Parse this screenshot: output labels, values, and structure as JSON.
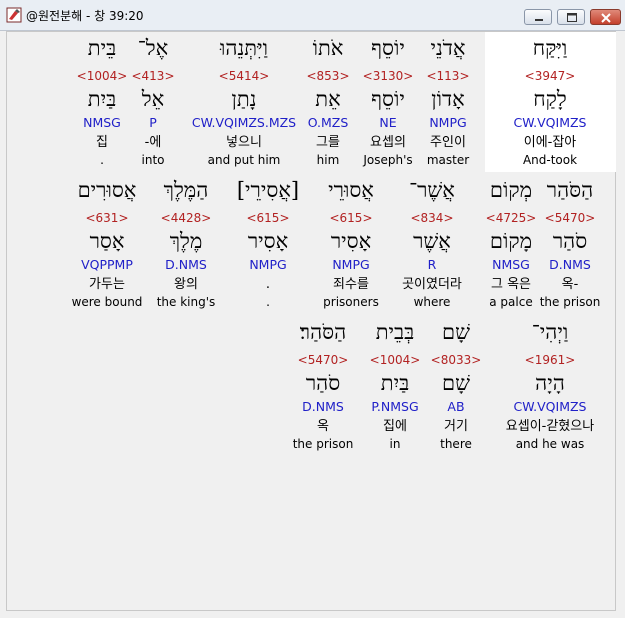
{
  "window": {
    "title": "@원전분해 - 창 39:20"
  },
  "colors": {
    "strong": "#b22222",
    "parse": "#2020c8",
    "highlight": "#ffffff"
  },
  "lines": [
    {
      "words": [
        {
          "heb": "וַיִּקַּח",
          "strong": "<3947>",
          "lex": "לָקַח",
          "parse": "CW.VQIMZS",
          "kor": "이에-잡아",
          "eng": "And-took"
        },
        {
          "heb": "אֲדֹנֵי",
          "strong": "<113>",
          "lex": "אָדוֹן",
          "parse": "NMPG",
          "kor": "주인이",
          "eng": "master"
        },
        {
          "heb": "יוֹסֵף",
          "strong": "<3130>",
          "lex": "יוֹסֵף",
          "parse": "NE",
          "kor": "요셉의",
          "eng": "Joseph's"
        },
        {
          "heb": "אֹתוֹ",
          "strong": "<853>",
          "lex": "אֵת",
          "parse": "O.MZS",
          "kor": "그를",
          "eng": "him"
        },
        {
          "heb": "וַיִּתְּנֵהוּ",
          "strong": "<5414>",
          "lex": "נָתַן",
          "parse": "CW.VQIMZS.MZS",
          "kor": "넣으니",
          "eng": "and put him"
        },
        {
          "heb": "אֶל־",
          "strong": "<413>",
          "lex": "אֵל",
          "parse": "P",
          "kor": "-에",
          "eng": "into"
        },
        {
          "heb": "בֵּית",
          "strong": "<1004>",
          "lex": "בַּיִת",
          "parse": "NMSG",
          "kor": "집",
          "eng": "."
        }
      ]
    },
    {
      "words": [
        {
          "heb": "הַסֹּהַר",
          "strong": "<5470>",
          "lex": "סֹהַר",
          "parse": "D.NMS",
          "kor": "옥-",
          "eng": "the prison"
        },
        {
          "heb": "מְקוֹם",
          "strong": "<4725>",
          "lex": "מָקוֹם",
          "parse": "NMSG",
          "kor": "그 옥은",
          "eng": "a palce"
        },
        {
          "heb": "אֲשֶׁר־",
          "strong": "<834>",
          "lex": "אֲשֶׁר",
          "parse": "R",
          "kor": "곳이였더라",
          "eng": "where"
        },
        {
          "heb": "אֲסוּרֵי",
          "strong": "<615>",
          "lex": "אָסִיר",
          "parse": "NMPG",
          "kor": "죄수를",
          "eng": "prisoners"
        },
        {
          "heb": "[אֲסִירֵי]",
          "strong": "<615>",
          "lex": "אָסִיר",
          "parse": "NMPG",
          "kor": ".",
          "eng": "."
        },
        {
          "heb": "הַמֶּלֶךְ",
          "strong": "<4428>",
          "lex": "מֶלֶךְ",
          "parse": "D.NMS",
          "kor": "왕의",
          "eng": "the king's"
        },
        {
          "heb": "אֲסוּרִים",
          "strong": "<631>",
          "lex": "אָסַר",
          "parse": "VQPPMP",
          "kor": "가두는",
          "eng": "were bound"
        }
      ]
    },
    {
      "words": [
        {
          "heb": "וַיְהִי־",
          "strong": "<1961>",
          "lex": "הָיָה",
          "parse": "CW.VQIMZS",
          "kor": "요셉이-갇혔으나",
          "eng": "and he was"
        },
        {
          "heb": "שָׁם",
          "strong": "<8033>",
          "lex": "שָׁם",
          "parse": "AB",
          "kor": "거기",
          "eng": "there"
        },
        {
          "heb": "בְּבֵית",
          "strong": "<1004>",
          "lex": "בַּיִת",
          "parse": "P.NMSG",
          "kor": "집에",
          "eng": "in"
        },
        {
          "heb": "הַסֹּהַר׃",
          "strong": "<5470>",
          "lex": "סֹהַר",
          "parse": "D.NMS",
          "kor": "옥",
          "eng": "the prison"
        }
      ]
    }
  ]
}
